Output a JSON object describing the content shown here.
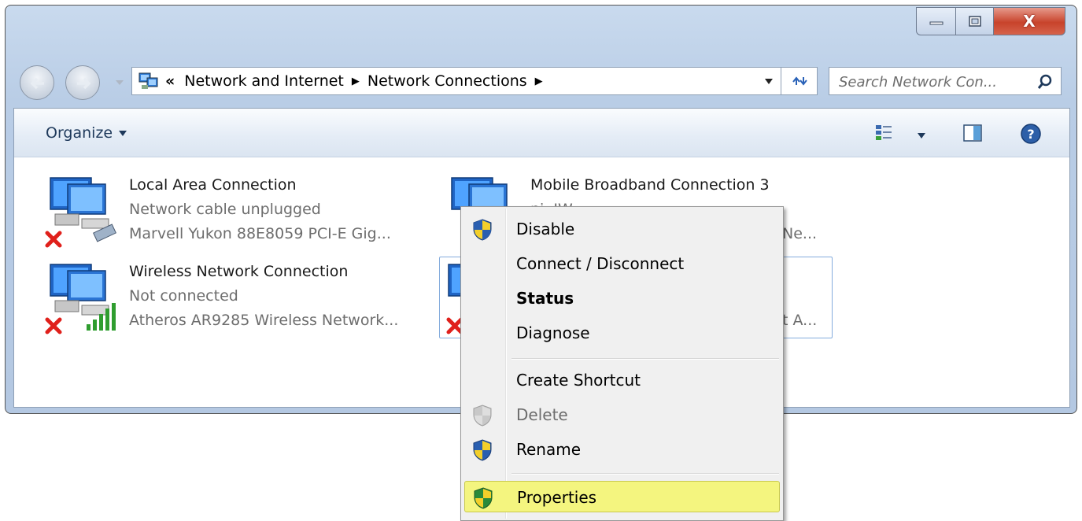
{
  "window": {
    "caption_buttons": {
      "minimize_icon": "minimize-icon",
      "maximize_icon": "maximize-icon",
      "close_glyph": "X"
    }
  },
  "nav": {
    "breadcrumb_overflow": "«",
    "breadcrumbs": [
      "Network and Internet",
      "Network Connections"
    ],
    "search_placeholder": "Search Network Con..."
  },
  "toolbar": {
    "organize_label": "Organize"
  },
  "connections": [
    {
      "name": "Local Area Connection",
      "status": "Network cable unplugged",
      "device": "Marvell Yukon 88E8059 PCI-E Gig..."
    },
    {
      "name": "Mobile Broadband Connection 3",
      "status": "ni..IW",
      "device": "Ne..."
    },
    {
      "name": "Wireless Network Connection",
      "status": "Not connected",
      "device": "Atheros AR9285 Wireless Network..."
    },
    {
      "name": "",
      "status": "",
      "device": "t A..."
    }
  ],
  "context_menu": {
    "items": [
      {
        "label": "Disable",
        "shield": true
      },
      {
        "label": "Connect / Disconnect",
        "shield": false
      },
      {
        "label": "Status",
        "shield": false,
        "bold": true
      },
      {
        "label": "Diagnose",
        "shield": false
      },
      {
        "label": "Create Shortcut",
        "shield": false
      },
      {
        "label": "Delete",
        "shield": true,
        "disabled": true
      },
      {
        "label": "Rename",
        "shield": true
      },
      {
        "label": "Properties",
        "shield": true,
        "highlighted": true
      }
    ]
  },
  "colors": {
    "highlight": "#f4f57f",
    "error_x": "#e0201b",
    "link_text": "#1e395b"
  }
}
